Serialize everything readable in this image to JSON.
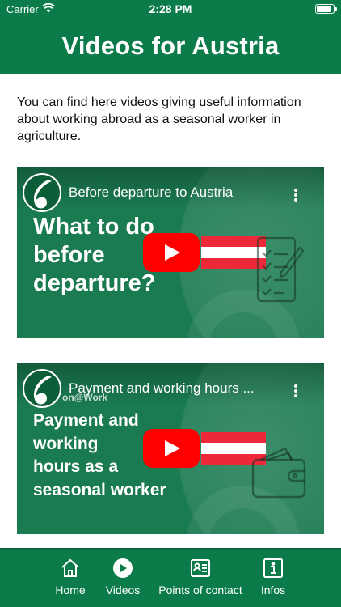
{
  "status_bar": {
    "carrier": "Carrier",
    "time": "2:28 PM"
  },
  "header": {
    "title": "Videos for Austria"
  },
  "intro": "You can find here videos giving useful information about working abroad as a seasonal worker in agriculture.",
  "videos": [
    {
      "title": "Before departure to Austria",
      "thumbnail_lines": [
        "What to do",
        "before",
        "departure?"
      ],
      "channel": ""
    },
    {
      "title": "Payment and working hours ...",
      "thumbnail_lines": [
        "Payment and",
        "working",
        "hours as a",
        "seasonal worker"
      ],
      "channel": "on@Work"
    }
  ],
  "tabs": [
    {
      "label": "Home",
      "icon": "home-icon"
    },
    {
      "label": "Videos",
      "icon": "play-circle-icon"
    },
    {
      "label": "Points of contact",
      "icon": "contact-card-icon"
    },
    {
      "label": "Infos",
      "icon": "info-icon"
    }
  ],
  "colors": {
    "brand_green": "#0b7b4a",
    "video_bg": "#1a7a50",
    "youtube_red": "#ff0000",
    "flag_red": "#ed2939"
  }
}
